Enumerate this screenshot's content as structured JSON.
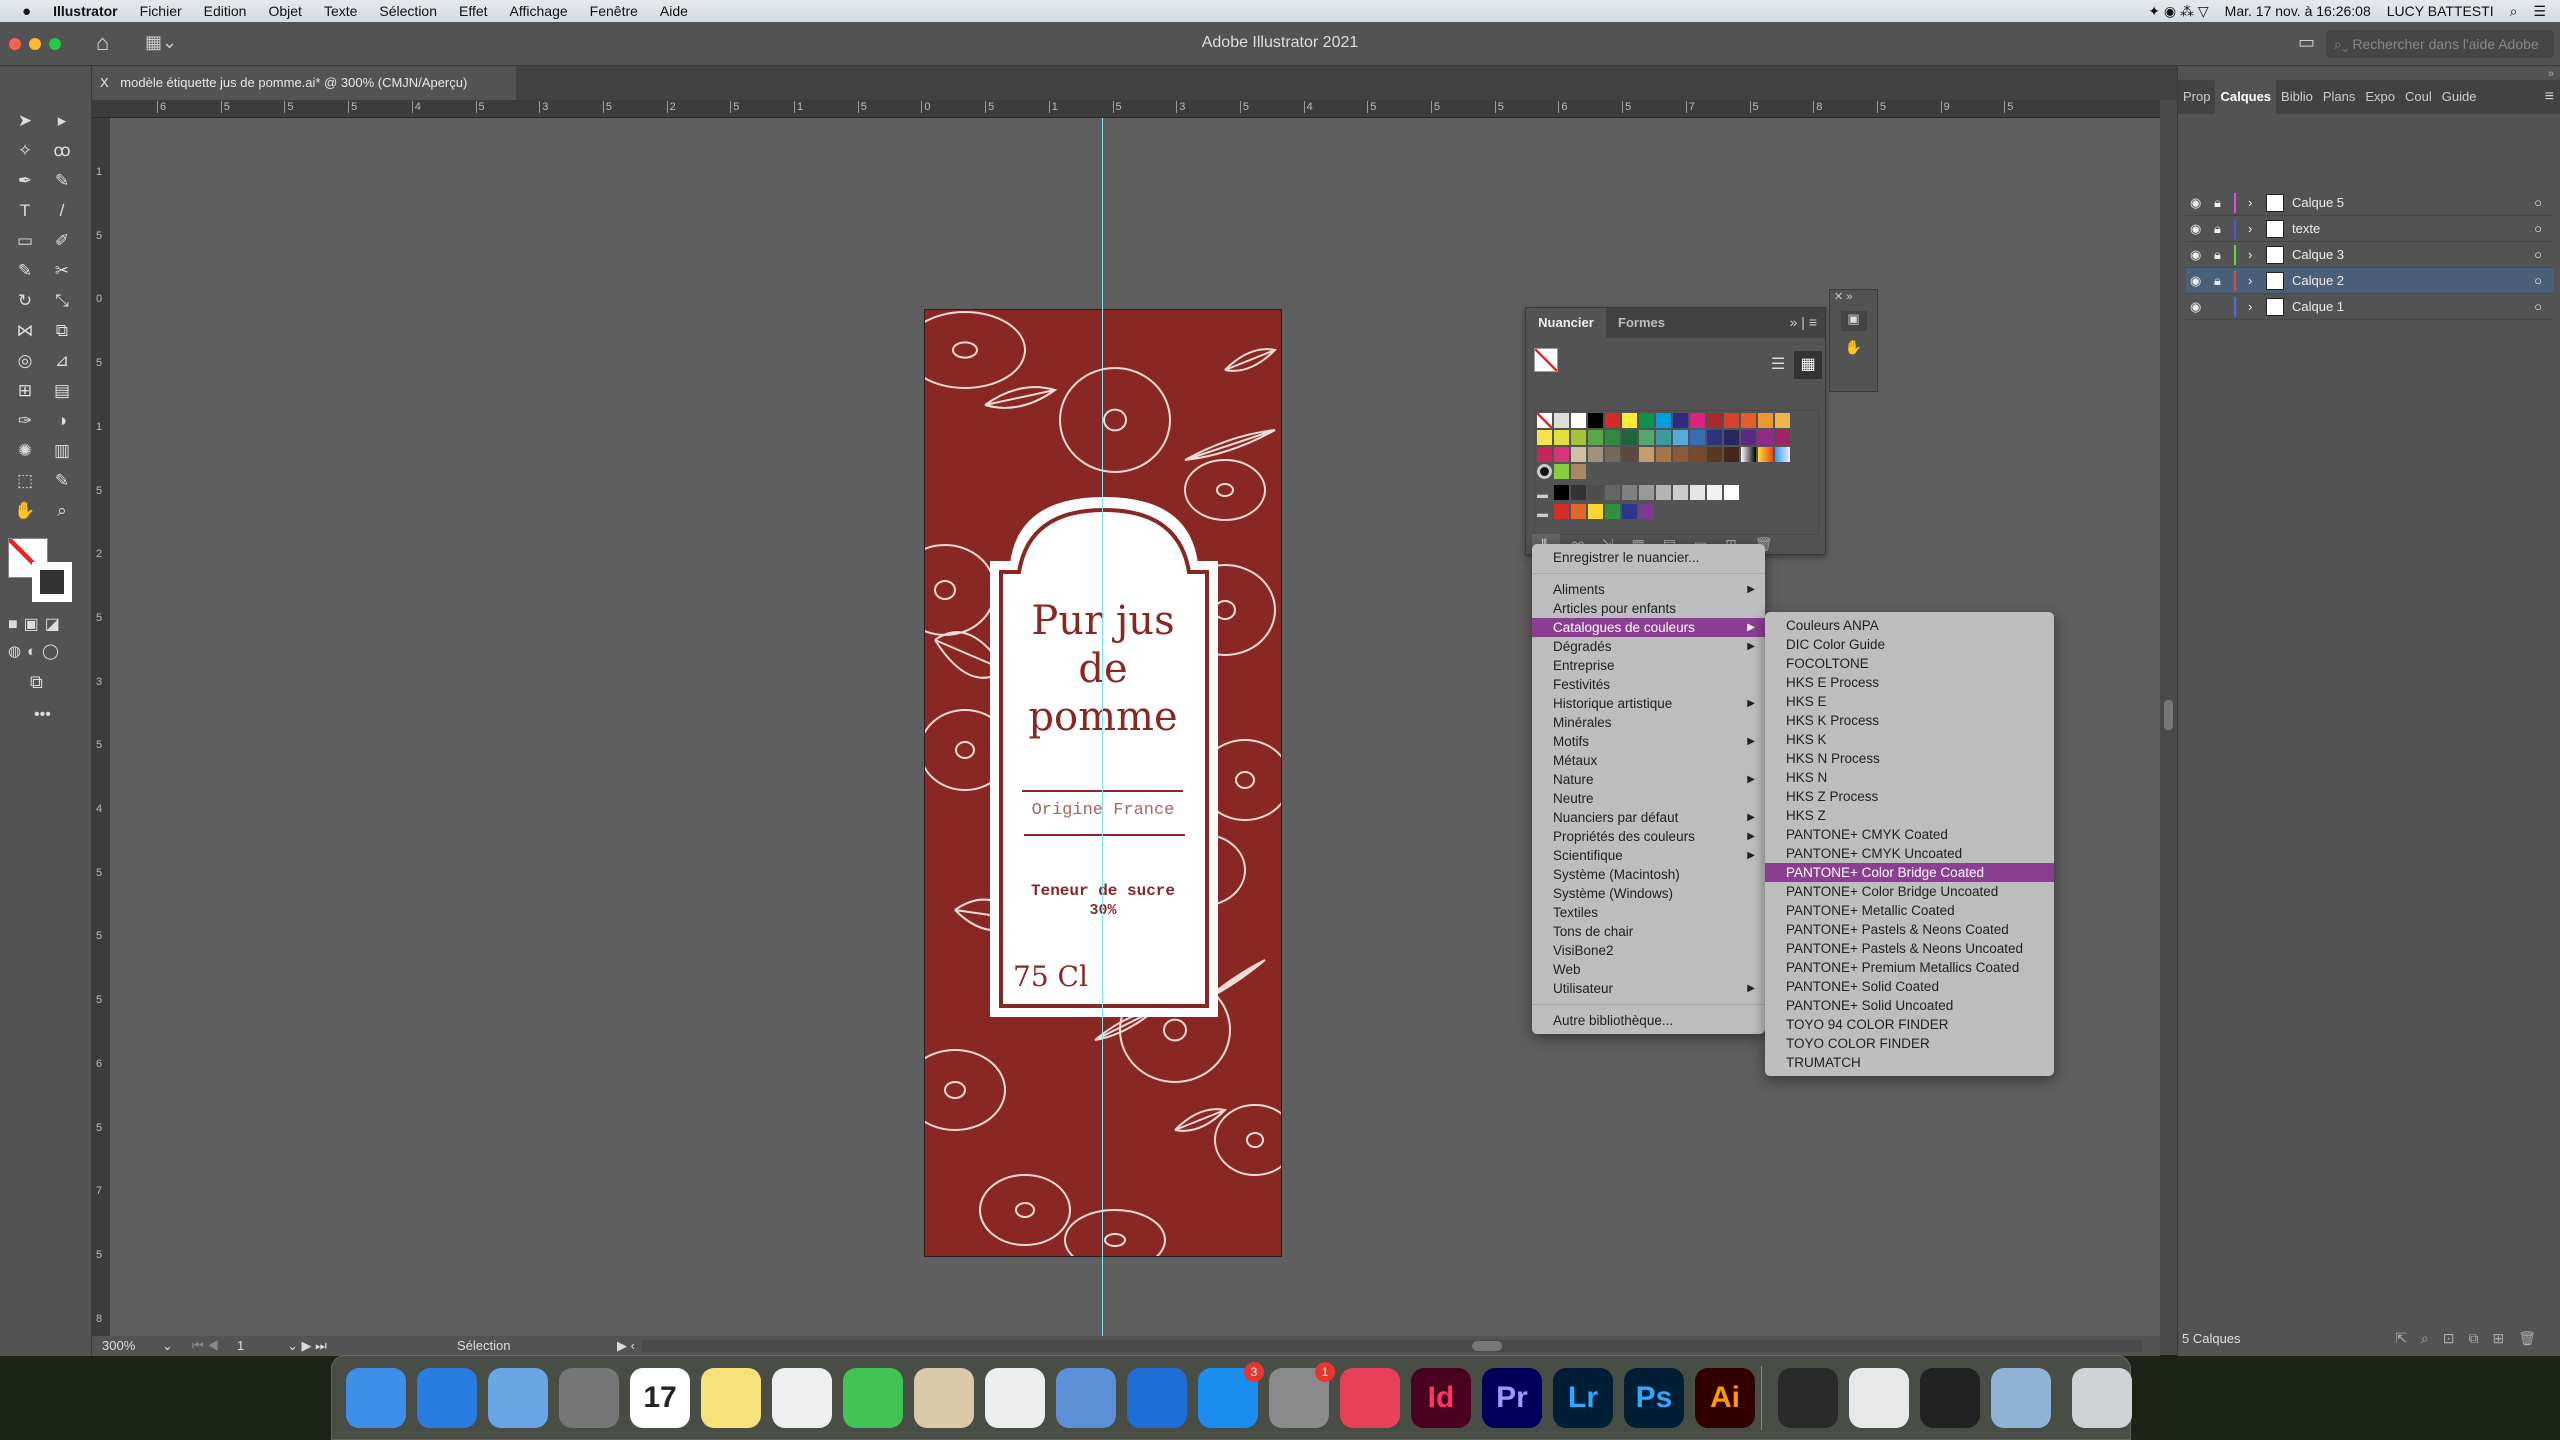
{
  "menubar": {
    "app": "Illustrator",
    "items": [
      "Fichier",
      "Edition",
      "Objet",
      "Texte",
      "Sélection",
      "Effet",
      "Affichage",
      "Fenêtre",
      "Aide"
    ],
    "clock": "Mar. 17 nov. à  16:26:08",
    "user": "LUCY BATTESTI"
  },
  "titlebar": {
    "title": "Adobe Illustrator 2021",
    "help_placeholder": "Rechercher dans l'aide Adobe"
  },
  "document": {
    "tab": "modèle étiquette jus de pomme.ai* @ 300% (CMJN/Aperçu)",
    "close": "X"
  },
  "ruler": {
    "top": [
      "6",
      "5",
      "5",
      "5",
      "4",
      "5",
      "3",
      "5",
      "2",
      "5",
      "1",
      "5",
      "0",
      "5",
      "1",
      "5",
      "3",
      "5",
      "4",
      "5",
      "5",
      "5",
      "6",
      "5",
      "7",
      "5",
      "8",
      "5",
      "9",
      "5"
    ],
    "left": [
      "1",
      "5",
      "0",
      "5",
      "1",
      "5",
      "2",
      "5",
      "3",
      "5",
      "4",
      "5",
      "5",
      "5",
      "6",
      "5",
      "7",
      "5",
      "8"
    ]
  },
  "label": {
    "title_line1": "Pur jus",
    "title_line2": "de",
    "title_line3": "pomme",
    "origin": "Origine France",
    "sugar_line1": "Teneur de sucre",
    "sugar_line2": "30%",
    "volume": "75 Cl",
    "background": "#882724"
  },
  "status": {
    "zoom": "300%",
    "page": "1",
    "tool": "Sélection"
  },
  "swatches_panel": {
    "tabs": [
      "Nuancier",
      "Formes"
    ],
    "row1": [
      "#ffffff",
      "#000000",
      "#d62b20",
      "#fbe93a",
      "#0a9447",
      "#069ddf",
      "#2f2a83",
      "#d9237d",
      "#a82a2c",
      "#d74230",
      "#e55d29",
      "#ea9732",
      "#f0b44e"
    ],
    "row2": [
      "#f4e34a",
      "#e0df3f",
      "#a5c23c",
      "#5aa845",
      "#318a3f",
      "#22643a",
      "#52a66f",
      "#3a9c9a",
      "#58aade",
      "#3a6db4",
      "#2b3483",
      "#2a2560",
      "#5d2986",
      "#92298b",
      "#9b2664"
    ],
    "row3": [
      "#c8265a",
      "#d6367c",
      "#cfbfa5",
      "#a39080",
      "#76695a",
      "#5b4a3d",
      "#c69c69",
      "#a8744a",
      "#8d5a34",
      "#7a4b27",
      "#5c381a",
      "#43281a"
    ],
    "grays": [
      "#000000",
      "#333333",
      "#4d4d4d",
      "#666666",
      "#808080",
      "#999999",
      "#b3b3b3",
      "#cccccc",
      "#e6e6e6",
      "#f2f2f2",
      "#ffffff"
    ],
    "group": [
      "#d22f27",
      "#e4662b",
      "#fbd63b",
      "#31913e",
      "#2e358d",
      "#7d3a93"
    ]
  },
  "menu": {
    "save": "Enregistrer le nuancier...",
    "items": [
      {
        "label": "Aliments",
        "sub": true
      },
      {
        "label": "Articles pour enfants",
        "sub": false
      },
      {
        "label": "Catalogues de couleurs",
        "sub": true,
        "selected": true
      },
      {
        "label": "Dégradés",
        "sub": true
      },
      {
        "label": "Entreprise",
        "sub": false
      },
      {
        "label": "Festivités",
        "sub": false
      },
      {
        "label": "Historique artistique",
        "sub": true
      },
      {
        "label": "Minérales",
        "sub": false
      },
      {
        "label": "Motifs",
        "sub": true
      },
      {
        "label": "Métaux",
        "sub": false
      },
      {
        "label": "Nature",
        "sub": true
      },
      {
        "label": "Neutre",
        "sub": false
      },
      {
        "label": "Nuanciers par défaut",
        "sub": true
      },
      {
        "label": "Propriétés des couleurs",
        "sub": true
      },
      {
        "label": "Scientifique",
        "sub": true
      },
      {
        "label": "Système (Macintosh)",
        "sub": false
      },
      {
        "label": "Système (Windows)",
        "sub": false
      },
      {
        "label": "Textiles",
        "sub": false
      },
      {
        "label": "Tons de chair",
        "sub": false
      },
      {
        "label": "VisiBone2",
        "sub": false
      },
      {
        "label": "Web",
        "sub": false
      },
      {
        "label": "Utilisateur",
        "sub": true
      }
    ],
    "other": "Autre bibliothèque...",
    "submenu": [
      "Couleurs ANPA",
      "DIC Color Guide",
      "FOCOLTONE",
      "HKS E Process",
      "HKS E",
      "HKS K Process",
      "HKS K",
      "HKS N Process",
      "HKS N",
      "HKS Z Process",
      "HKS Z",
      "PANTONE+ CMYK Coated",
      "PANTONE+ CMYK Uncoated",
      "PANTONE+ Color Bridge Coated",
      "PANTONE+ Color Bridge Uncoated",
      "PANTONE+ Metallic Coated",
      "PANTONE+ Pastels & Neons Coated",
      "PANTONE+ Pastels & Neons Uncoated",
      "PANTONE+ Premium Metallics Coated",
      "PANTONE+ Solid Coated",
      "PANTONE+ Solid Uncoated",
      "TOYO 94 COLOR FINDER",
      "TOYO COLOR FINDER",
      "TRUMATCH"
    ],
    "submenu_selected": 13,
    "highlight": "#8c3e92"
  },
  "layers_panel": {
    "tabs": [
      "Prop",
      "Calques",
      "Biblio",
      "Plans",
      "Expo",
      "Coul",
      "Guide"
    ],
    "active_tab": 1,
    "layers": [
      {
        "name": "Calque 5",
        "color": "#e04fd8",
        "locked": true
      },
      {
        "name": "texte",
        "color": "#4a55e0",
        "locked": true
      },
      {
        "name": "Calque 3",
        "color": "#5ed64a",
        "locked": true
      },
      {
        "name": "Calque 2",
        "color": "#e04a3a",
        "locked": true,
        "selected": true
      },
      {
        "name": "Calque 1",
        "color": "#4a6ae0",
        "locked": false
      }
    ],
    "count": "5 Calques"
  },
  "dock": [
    {
      "name": "Finder",
      "color": "#3d8ee8"
    },
    {
      "name": "Safari",
      "color": "#2a7de0"
    },
    {
      "name": "Mail",
      "color": "#6aa6e6"
    },
    {
      "name": "Launchpad",
      "color": "#777"
    },
    {
      "name": "Calendrier",
      "color": "#fff",
      "text": "17"
    },
    {
      "name": "Notes",
      "color": "#f7e27a"
    },
    {
      "name": "Photos",
      "color": "#f0f0f0"
    },
    {
      "name": "FaceTime",
      "color": "#3fc455"
    },
    {
      "name": "Aperçu",
      "color": "#d9c9a8"
    },
    {
      "name": "Fichier",
      "color": "#eee"
    },
    {
      "name": "Keynote",
      "color": "#5d8fd6"
    },
    {
      "name": "TeamViewer",
      "color": "#1e6ed6"
    },
    {
      "name": "App Store",
      "color": "#1c8ef0",
      "badge": "3"
    },
    {
      "name": "Préférences Système",
      "color": "#8a8a8a",
      "badge": "1"
    },
    {
      "name": "Creative Cloud",
      "color": "#e9405a"
    },
    {
      "name": "InDesign",
      "color": "#49021f",
      "text": "Id",
      "fg": "#ff3366"
    },
    {
      "name": "Premiere Pro",
      "color": "#00005b",
      "text": "Pr",
      "fg": "#9999ff"
    },
    {
      "name": "Lightroom",
      "color": "#001e36",
      "text": "Lr",
      "fg": "#31a8ff"
    },
    {
      "name": "Photoshop",
      "color": "#001e36",
      "text": "Ps",
      "fg": "#31a8ff"
    },
    {
      "name": "Illustrator",
      "color": "#330000",
      "text": "Ai",
      "fg": "#ff9a00"
    },
    {
      "name": "QuickTime",
      "color": "#2a2a2a"
    },
    {
      "name": "Chrome",
      "color": "#e8e8e8"
    },
    {
      "name": "Acrobat",
      "color": "#222"
    },
    {
      "name": "Aperçu images",
      "color": "#8fb2d6"
    },
    {
      "name": "Corbeille",
      "color": "#cfd3d6"
    }
  ]
}
